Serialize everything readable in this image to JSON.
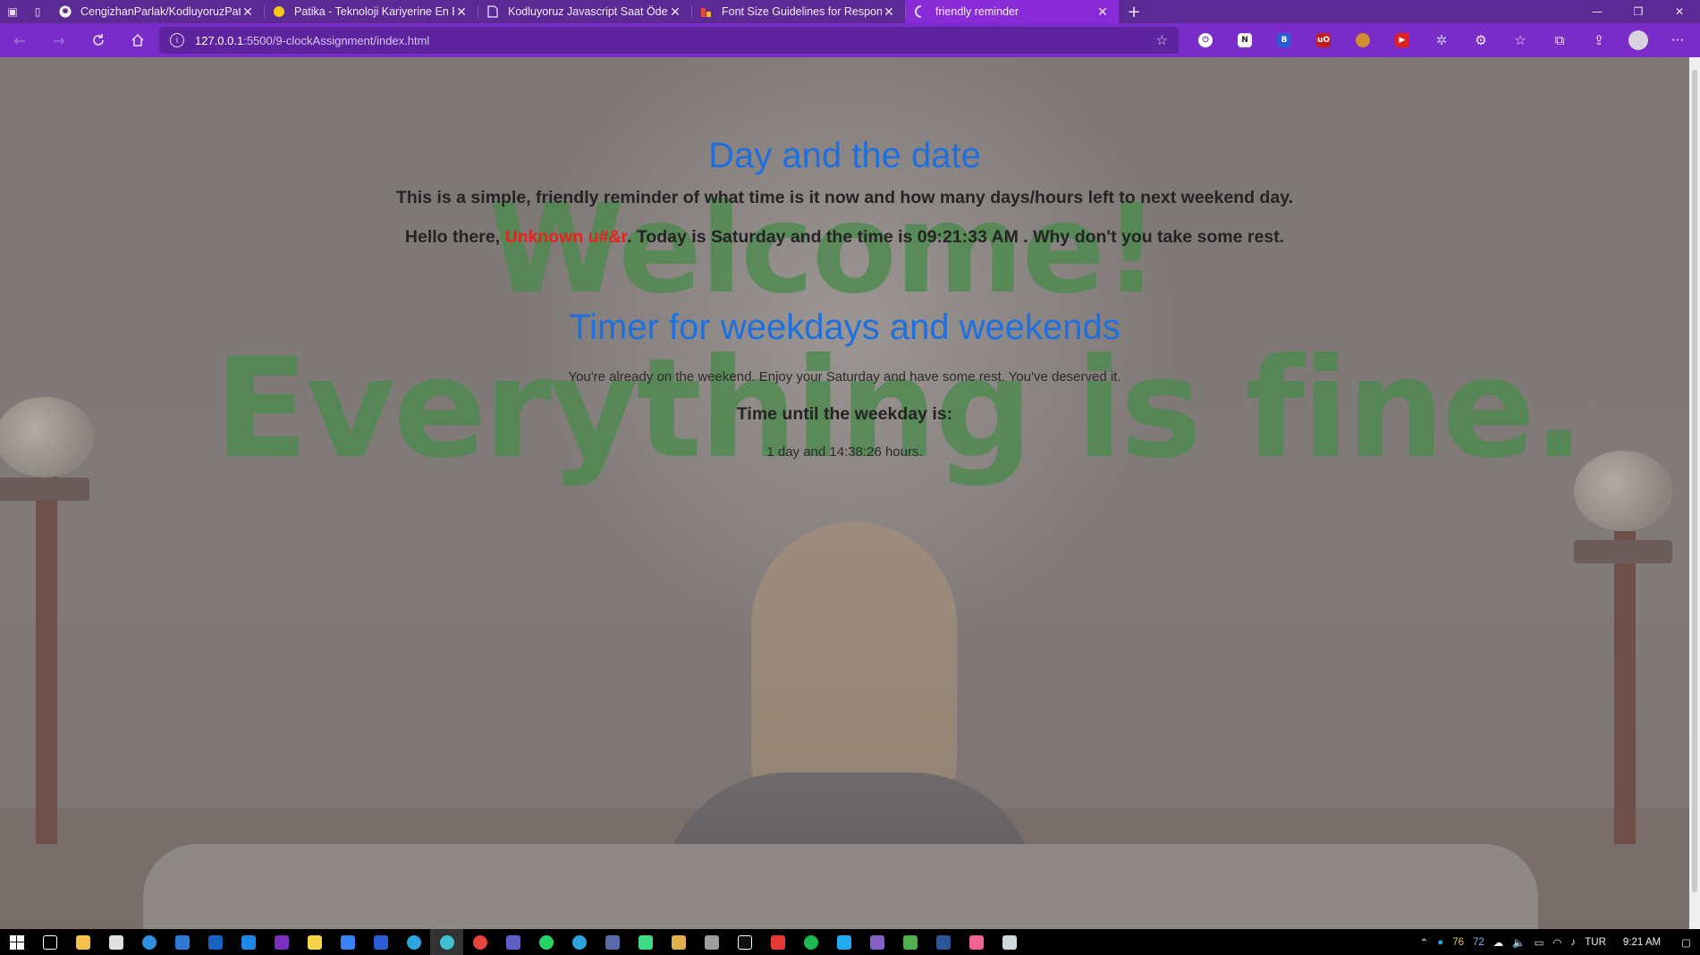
{
  "browser": {
    "tabs": [
      {
        "title": "CengizhanParlak/KodluyoruzPat",
        "icon": "github-icon"
      },
      {
        "title": "Patika - Teknoloji Kariyerine En E",
        "icon": "patika-icon"
      },
      {
        "title": "Kodluyoruz Javascript Saat Ödev",
        "icon": "document-icon"
      },
      {
        "title": "Font Size Guidelines for Respon",
        "icon": "site-icon"
      },
      {
        "title": "friendly reminder",
        "icon": "loading-icon"
      }
    ],
    "address": {
      "host": "127.0.0.1",
      "path": ":5500/9-clockAssignment/index.html"
    }
  },
  "page": {
    "watermark_line1": "Welcome!",
    "watermark_line2": "Everything is fine.",
    "title1": "Day and the date",
    "intro": "This is a simple, friendly reminder of what time is it now and how many days/hours left to next weekend day.",
    "greeting_prefix": "Hello there, ",
    "user_name": "Unknown u#&r",
    "greeting_suffix": ". Today is Saturday and the time is 09:21:33 AM . Why don't you take some rest.",
    "title2": "Timer for weekdays and weekends",
    "weekend_message": "You're already on the weekend. Enjoy your Saturday and have some rest. You've deserved it.",
    "until_label": "Time until the weekday is:",
    "countdown": "1 day and 14:38:26 hours."
  },
  "taskbar": {
    "tray_numbers": [
      "76",
      "72"
    ],
    "language": "TUR",
    "time": "9:21 AM"
  },
  "colors": {
    "browser_tabbar": "#5b2a94",
    "browser_toolbar": "#7a2cc9",
    "heading_blue": "#1e6fe0",
    "username_red": "#e8221c",
    "watermark_green": "#4f8a4f"
  }
}
